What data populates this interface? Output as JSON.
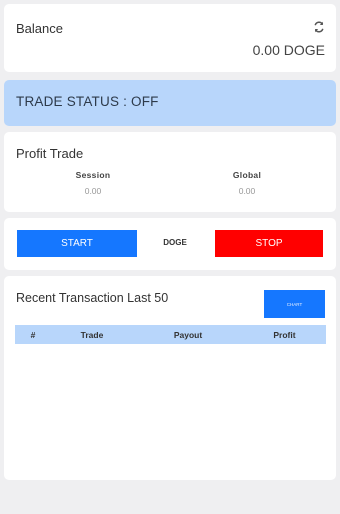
{
  "balance": {
    "label": "Balance",
    "value": "0.00 DOGE",
    "refresh_icon": "refresh-icon"
  },
  "trade_status": {
    "text": "TRADE STATUS : OFF",
    "color": "#b8d6fb"
  },
  "profit": {
    "title": "Profit Trade",
    "session_label": "Session",
    "session_value": "0.00",
    "global_label": "Global",
    "global_value": "0.00"
  },
  "controls": {
    "start_label": "START",
    "coin": "DOGE",
    "stop_label": "STOP",
    "start_color": "#1577ff",
    "stop_color": "#ff0000"
  },
  "transactions": {
    "title": "Recent Transaction Last 50",
    "chart_button": "CHART",
    "columns": [
      "#",
      "Trade",
      "Payout",
      "Profit"
    ],
    "rows": []
  }
}
